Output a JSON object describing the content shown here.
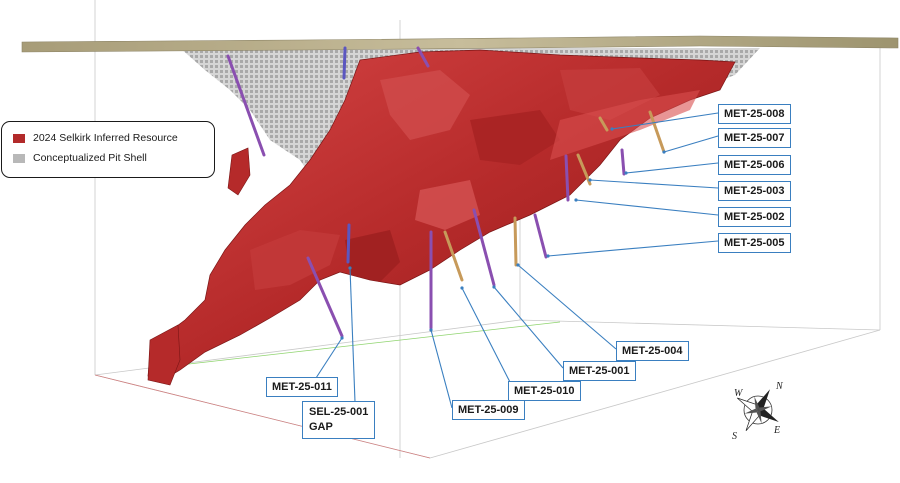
{
  "legend": {
    "items": [
      {
        "label": "2024 Selkirk Inferred Resource",
        "color": "#b22a2a"
      },
      {
        "label": "Conceptualized Pit Shell",
        "color": "#b8b8b8"
      }
    ]
  },
  "drillholes": {
    "met_25_008": "MET-25-008",
    "met_25_007": "MET-25-007",
    "met_25_006": "MET-25-006",
    "met_25_003": "MET-25-003",
    "met_25_002": "MET-25-002",
    "met_25_005": "MET-25-005",
    "met_25_004": "MET-25-004",
    "met_25_001": "MET-25-001",
    "met_25_010": "MET-25-010",
    "met_25_009": "MET-25-009",
    "met_25_011": "MET-25-011",
    "sel_25_001_line1": "SEL-25-001",
    "sel_25_001_line2": "GAP"
  },
  "compass": {
    "n": "N",
    "s": "S",
    "e": "E",
    "w": "W"
  },
  "colors": {
    "resource": "#b22a2a",
    "pit_shell": "#b8b8b8",
    "drillhole_purple": "#8a4fb0",
    "drillhole_tan": "#c79a5a",
    "callout": "#3a7fc0",
    "surface": "#b7ad8a"
  }
}
